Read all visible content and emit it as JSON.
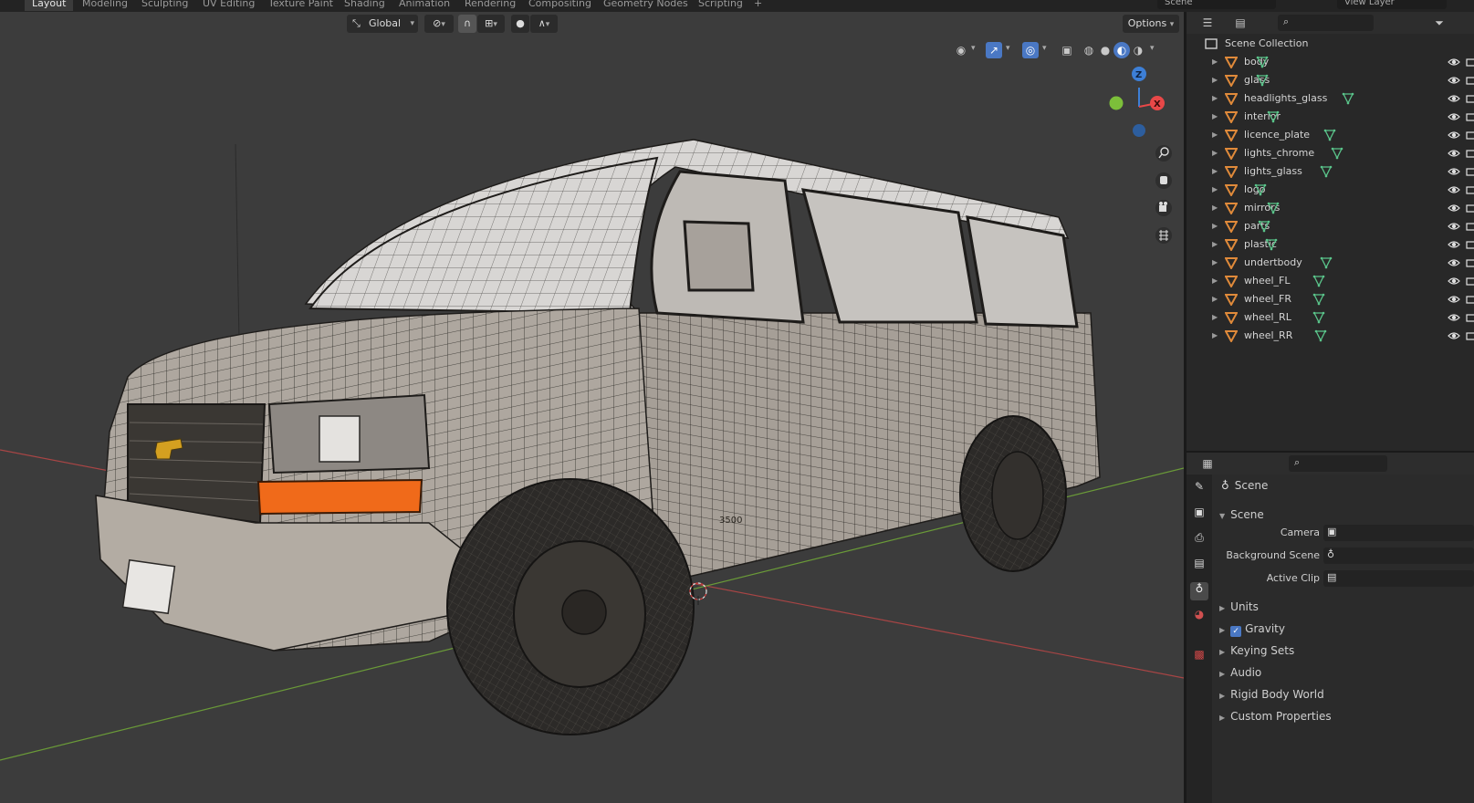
{
  "workspace_tabs": [
    "Layout",
    "Modeling",
    "Sculpting",
    "UV Editing",
    "Texture Paint",
    "Shading",
    "Animation",
    "Rendering",
    "Compositing",
    "Geometry Nodes",
    "Scripting"
  ],
  "top_right": {
    "scene": "Scene",
    "view_layer": "View Layer"
  },
  "viewport_header": {
    "transform_orientation": "Global",
    "options_label": "Options"
  },
  "outliner": {
    "root": "Scene Collection",
    "objects": [
      "body",
      "glass",
      "headlights_glass",
      "interior",
      "licence_plate",
      "lights_chrome",
      "lights_glass",
      "logo",
      "mirrors",
      "parts",
      "plastic",
      "undertbody",
      "wheel_FL",
      "wheel_FR",
      "wheel_RL",
      "wheel_RR"
    ]
  },
  "properties": {
    "context": "Scene",
    "section": "Scene",
    "fields": {
      "camera": "Camera",
      "background_scene": "Background Scene",
      "active_clip": "Active Clip"
    },
    "panels": [
      "Units",
      "Gravity",
      "Keying Sets",
      "Audio",
      "Rigid Body World",
      "Custom Properties"
    ],
    "gravity_checked": true
  },
  "van_logo_text": "3500",
  "colors": {
    "axis_x": "#e84848",
    "axis_y": "#7cbf3a",
    "axis_z": "#3d7fd6",
    "object_orange": "#e08a3a",
    "mesh_green": "#5ac48a",
    "accent_blue": "#4a78c4"
  }
}
